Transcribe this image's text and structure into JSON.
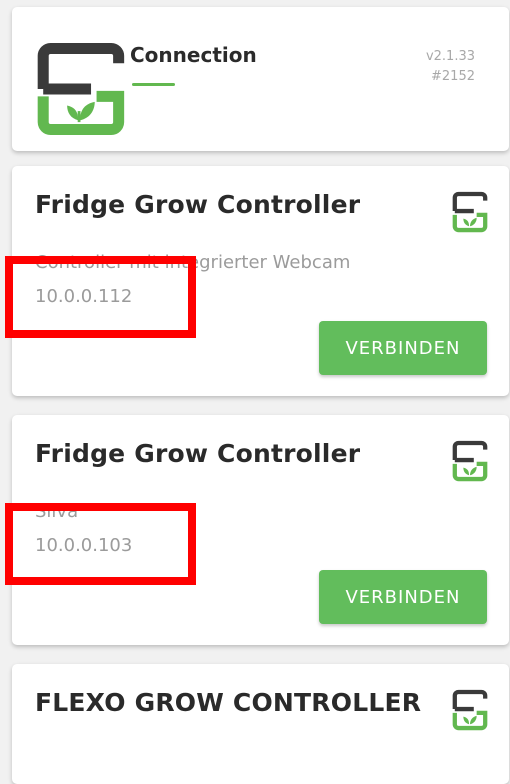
{
  "header": {
    "title": "Connection",
    "version": "v2.1.33",
    "build": "#2152",
    "logo_icon": "fg-logo-icon"
  },
  "colors": {
    "accent_green": "#62bd5c",
    "logo_dark": "#3a3a3a",
    "highlight_red": "#ff0000",
    "text_gray": "#9b9b9b"
  },
  "devices": [
    {
      "title": "Fridge Grow Controller",
      "description": "Controller mit integrierter Webcam",
      "ip": "10.0.0.112",
      "button_label": "VERBINDEN",
      "icon": "fg-logo-icon"
    },
    {
      "title": "Fridge Grow Controller",
      "description": "Silva",
      "ip": "10.0.0.103",
      "button_label": "VERBINDEN",
      "icon": "fg-logo-icon"
    },
    {
      "title": "FLEXO GROW CONTROLLER",
      "icon": "fg-logo-icon"
    }
  ]
}
